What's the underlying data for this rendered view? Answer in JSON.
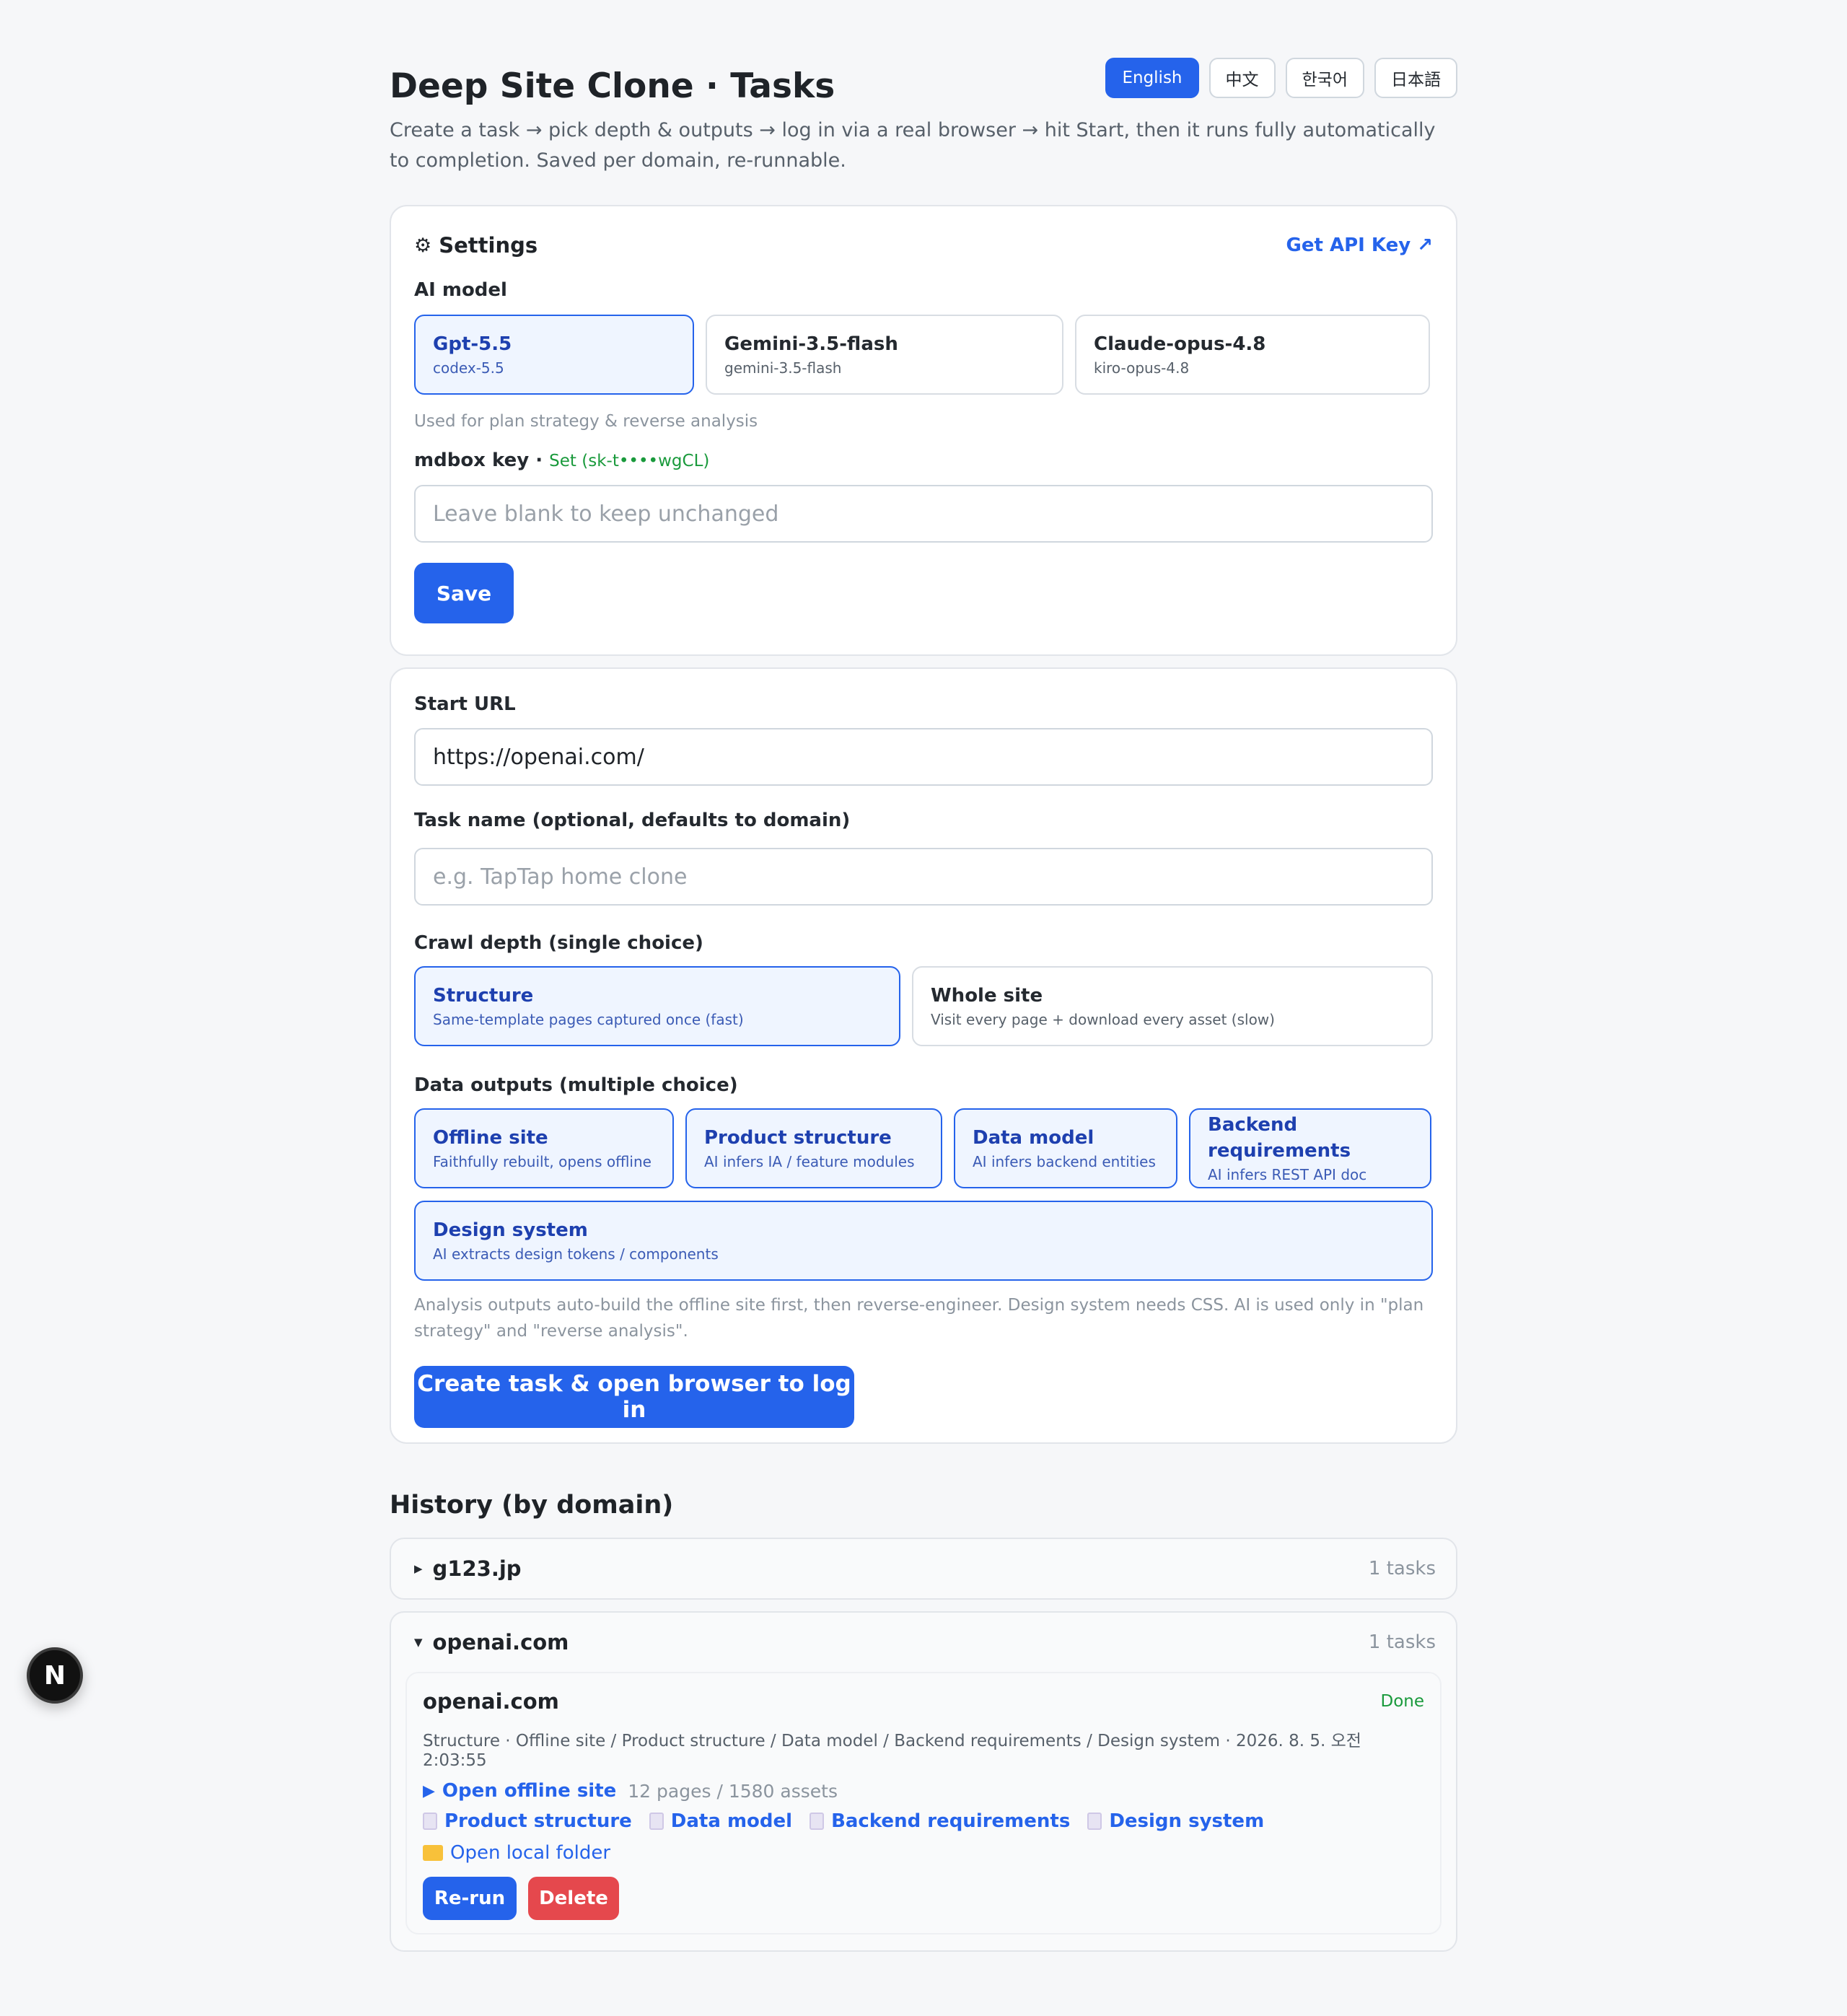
{
  "header": {
    "title": "Deep Site Clone · Tasks",
    "subtitle": "Create a task → pick depth & outputs → log in via a real browser → hit Start, then it runs fully automatically to completion. Saved per domain, re-runnable.",
    "languages": [
      "English",
      "中文",
      "한국어",
      "日本語"
    ],
    "active_language": "English"
  },
  "settings": {
    "icon": "gear-icon",
    "title": "Settings",
    "api_link": "Get API Key ↗",
    "ai_model_label": "AI model",
    "models": [
      {
        "name": "Gpt-5.5",
        "id": "codex-5.5",
        "selected": true
      },
      {
        "name": "Gemini-3.5-flash",
        "id": "gemini-3.5-flash",
        "selected": false
      },
      {
        "name": "Claude-opus-4.8",
        "id": "kiro-opus-4.8",
        "selected": false
      }
    ],
    "model_hint": "Used for plan strategy & reverse analysis",
    "key_label": "mdbox key",
    "key_sep": " · ",
    "key_status": "Set (sk-t••••wgCL)",
    "key_placeholder": "Leave blank to keep unchanged",
    "save_label": "Save"
  },
  "task_form": {
    "start_url_label": "Start URL",
    "start_url_value": "https://openai.com/",
    "task_name_label": "Task name (optional, defaults to domain)",
    "task_name_placeholder": "e.g. TapTap home clone",
    "depth_label": "Crawl depth (single choice)",
    "depth_options": [
      {
        "title": "Structure",
        "desc": "Same-template pages captured once (fast)",
        "selected": true
      },
      {
        "title": "Whole site",
        "desc": "Visit every page + download every asset (slow)",
        "selected": false
      }
    ],
    "outputs_label": "Data outputs (multiple choice)",
    "outputs": [
      {
        "title": "Offline site",
        "desc": "Faithfully rebuilt, opens offline",
        "selected": true
      },
      {
        "title": "Product structure",
        "desc": "AI infers IA / feature modules",
        "selected": true
      },
      {
        "title": "Data model",
        "desc": "AI infers backend entities",
        "selected": true
      },
      {
        "title": "Backend requirements",
        "desc": "AI infers REST API doc",
        "selected": true
      },
      {
        "title": "Design system",
        "desc": "AI extracts design tokens / components",
        "selected": true
      }
    ],
    "note": "Analysis outputs auto-build the offline site first, then reverse-engineer. Design system needs CSS. AI is used only in \"plan strategy\" and \"reverse analysis\".",
    "create_label": "Create task & open browser to log in"
  },
  "history": {
    "title": "History (by domain)",
    "domains": [
      {
        "name": "g123.jp",
        "count": "1 tasks",
        "expanded": false
      },
      {
        "name": "openai.com",
        "count": "1 tasks",
        "expanded": true
      }
    ],
    "task": {
      "name": "openai.com",
      "status": "Done",
      "meta": "Structure · Offline site / Product structure / Data model / Backend requirements / Design system · 2026. 8. 5. 오전 2:03:55",
      "open_offline": "Open offline site",
      "offline_stats": "12 pages / 1580 assets",
      "docs": [
        "Product structure",
        "Data model",
        "Backend requirements",
        "Design system"
      ],
      "open_folder": "Open local folder",
      "rerun_label": "Re-run",
      "delete_label": "Delete"
    }
  },
  "floating": {
    "badge": "N"
  },
  "colors": {
    "accent": "#2563eb",
    "success": "#1a9a3c",
    "danger": "#e5484d"
  }
}
